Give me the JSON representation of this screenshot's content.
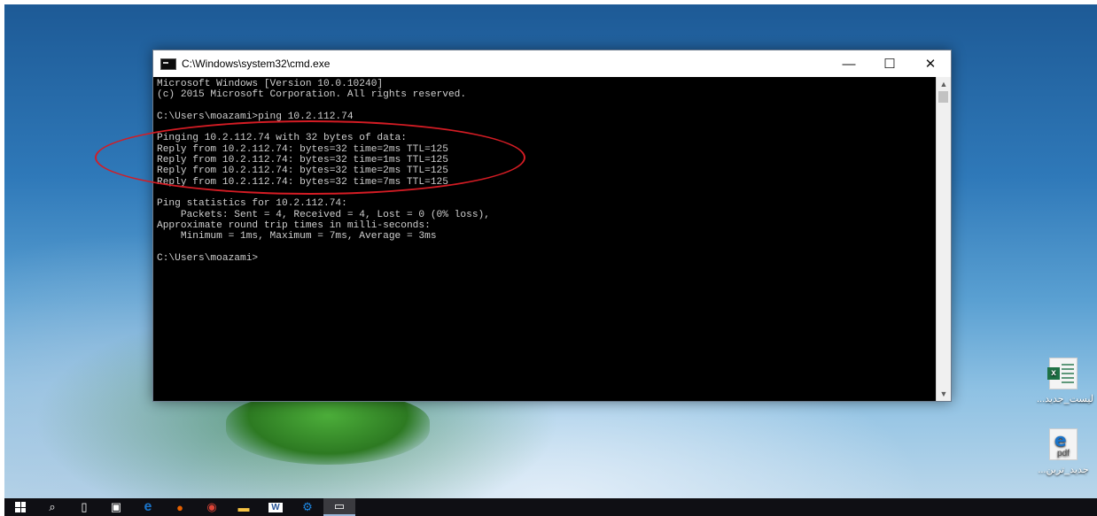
{
  "window": {
    "title": "C:\\Windows\\system32\\cmd.exe",
    "controls": {
      "minimize": "—",
      "maximize": "☐",
      "close": "✕"
    }
  },
  "console": {
    "lines": [
      "Microsoft Windows [Version 10.0.10240]",
      "(c) 2015 Microsoft Corporation. All rights reserved.",
      "",
      "C:\\Users\\moazami>ping 10.2.112.74",
      "",
      "Pinging 10.2.112.74 with 32 bytes of data:",
      "Reply from 10.2.112.74: bytes=32 time=2ms TTL=125",
      "Reply from 10.2.112.74: bytes=32 time=1ms TTL=125",
      "Reply from 10.2.112.74: bytes=32 time=2ms TTL=125",
      "Reply from 10.2.112.74: bytes=32 time=7ms TTL=125",
      "",
      "Ping statistics for 10.2.112.74:",
      "    Packets: Sent = 4, Received = 4, Lost = 0 (0% loss),",
      "Approximate round trip times in milli-seconds:",
      "    Minimum = 1ms, Maximum = 7ms, Average = 3ms",
      "",
      "C:\\Users\\moazami>"
    ]
  },
  "scrollbar": {
    "up_arrow": "▲",
    "down_arrow": "▼"
  },
  "annotation": {
    "color": "#d41c24"
  },
  "desktop_icons": [
    {
      "label": "...لیست_جدید",
      "icon": "excel-file-icon",
      "badge": "x"
    },
    {
      "label": "...جدید_ترین",
      "icon": "pdf-file-icon",
      "badge": "e",
      "sub": "pdf"
    }
  ],
  "taskbar": {
    "items": [
      {
        "name": "start-button",
        "glyph": ""
      },
      {
        "name": "search-button",
        "glyph": "⌕"
      },
      {
        "name": "task-view-button",
        "glyph": "▯"
      },
      {
        "name": "app-1-button",
        "glyph": "▣"
      },
      {
        "name": "edge-button",
        "glyph": "e"
      },
      {
        "name": "firefox-button",
        "glyph": "●"
      },
      {
        "name": "chrome-button",
        "glyph": "◉"
      },
      {
        "name": "file-explorer-button",
        "glyph": "▬"
      },
      {
        "name": "word-button",
        "glyph": "W"
      },
      {
        "name": "settings-button",
        "glyph": "⚙"
      },
      {
        "name": "cmd-button",
        "glyph": "▭"
      }
    ],
    "colors": {
      "edge": "#1a73c8",
      "firefox": "#e66000",
      "chrome": "#db4437",
      "explorer": "#f6c344",
      "word": "#2b579a",
      "settings": "#1e88e5"
    }
  }
}
